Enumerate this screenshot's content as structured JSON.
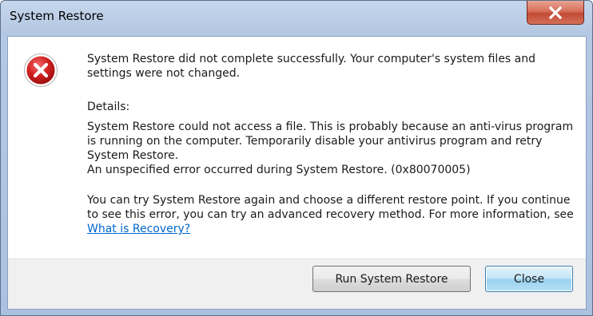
{
  "window": {
    "title": "System Restore"
  },
  "message": {
    "summary": "System Restore did not complete successfully. Your computer's system files and settings were not changed.",
    "details_heading": "Details:",
    "details_text_1": "System Restore could not access a file. This is probably because an anti-virus program is running on the computer. Temporarily disable your antivirus program and retry System Restore.",
    "details_text_2": "An unspecified error occurred during System Restore. (0x80070005)",
    "help_text": "You can try System Restore again and choose a different restore point.  If you continue to see this error, you can try an advanced recovery method. For more information, see ",
    "help_link": "What is Recovery?"
  },
  "buttons": {
    "run_label": "Run System Restore",
    "close_label": "Close"
  },
  "icons": {
    "status": "error-icon",
    "title_close": "close-icon"
  },
  "colors": {
    "link": "#0066cc",
    "error_red": "#cf1f1f"
  }
}
